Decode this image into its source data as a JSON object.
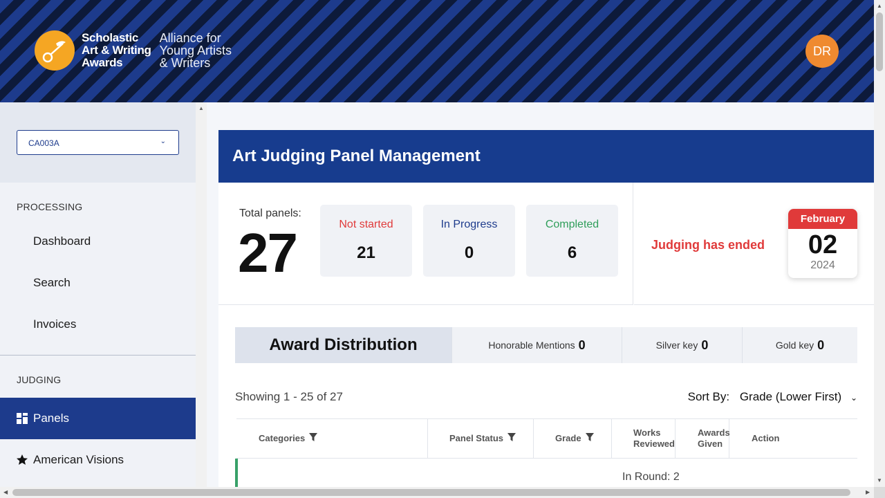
{
  "header": {
    "logo_line1": "Scholastic",
    "logo_line2": "Art & Writing",
    "logo_line3": "Awards",
    "sub_line1": "Alliance for",
    "sub_line2": "Young Artists",
    "sub_line3": "& Writers",
    "avatar_initials": "DR"
  },
  "sidebar": {
    "selected_region": "CA003A",
    "section_processing": "PROCESSING",
    "processing_items": [
      "Dashboard",
      "Search",
      "Invoices"
    ],
    "section_judging": "JUDGING",
    "active_item": "Panels",
    "next_item": "American Visions"
  },
  "main": {
    "title": "Art Judging Panel Management",
    "total_label": "Total panels:",
    "total_value": "27",
    "stats": [
      {
        "label": "Not started",
        "value": "21",
        "color": "#e03a3a"
      },
      {
        "label": "In Progress",
        "value": "0",
        "color": "#1d3b8c"
      },
      {
        "label": "Completed",
        "value": "6",
        "color": "#2f9e5a"
      }
    ],
    "judging_status": "Judging has ended",
    "calendar": {
      "month": "February",
      "day": "02",
      "year": "2024"
    },
    "award_title": "Award Distribution",
    "awards": [
      {
        "label": "Honorable Mentions",
        "value": "0"
      },
      {
        "label": "Silver key",
        "value": "0"
      },
      {
        "label": "Gold key",
        "value": "0"
      }
    ],
    "showing": "Showing 1 - 25 of 27",
    "sort_label": "Sort By:",
    "sort_value": "Grade (Lower First)",
    "columns": {
      "categories": "Categories",
      "panel_status": "Panel Status",
      "grade": "Grade",
      "works_reviewed_1": "Works",
      "works_reviewed_2": "Reviewed",
      "awards_given_1": "Awards",
      "awards_given_2": "Given",
      "action": "Action"
    },
    "row1_text": "In Round: 2"
  }
}
